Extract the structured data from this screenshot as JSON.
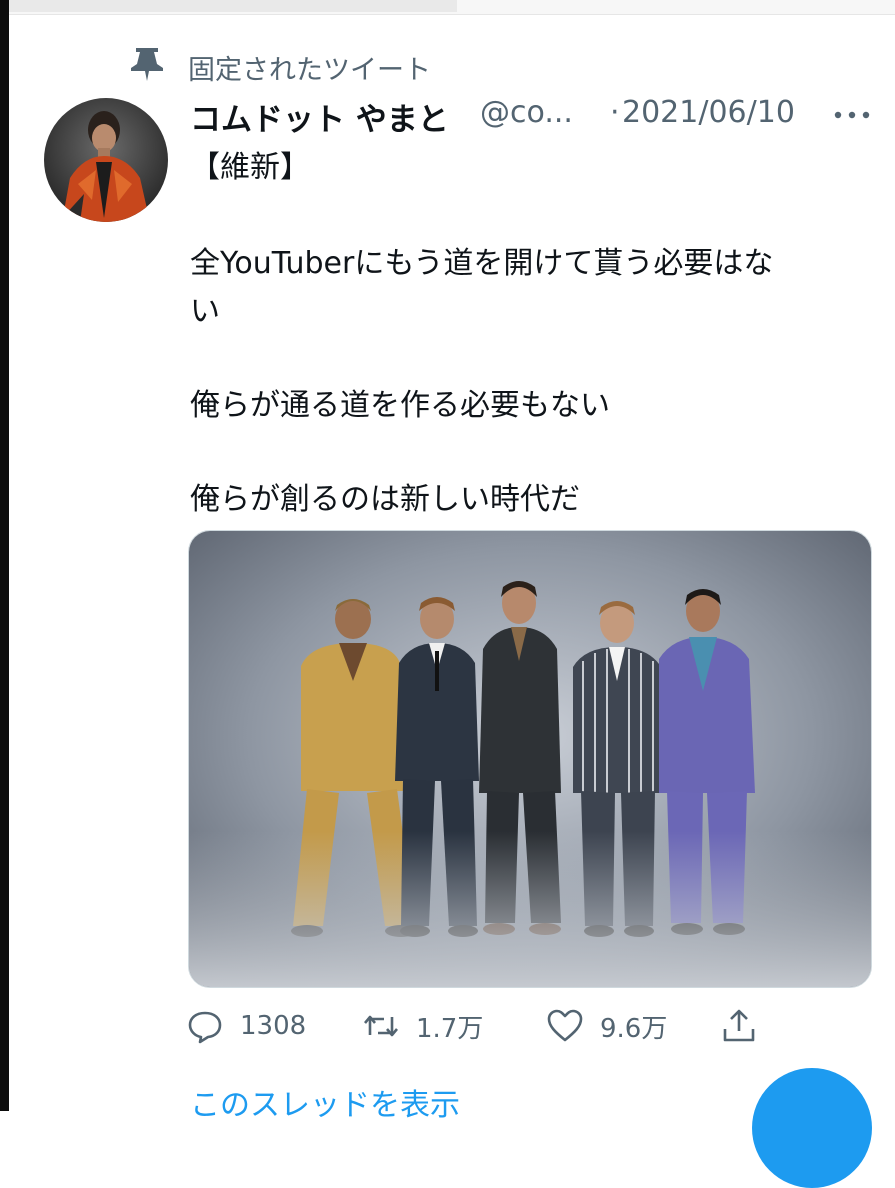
{
  "colors": {
    "accent": "#1d9bf0",
    "secondary_text": "#536471",
    "primary_text": "#0f1419"
  },
  "pinned": {
    "icon": "pin-icon",
    "label": "固定されたツイート"
  },
  "tweet": {
    "display_name": "コムドット やまと",
    "handle": "@co...",
    "separator": "·",
    "date": "2021/06/10",
    "lines": [
      "【維新】",
      "全YouTuberにもう道を開けて貰う必要はな",
      "い",
      "俺らが通る道を作る必要もない",
      "俺らが創るのは新しい時代だ"
    ]
  },
  "actions": {
    "reply_count": "1308",
    "retweet_count": "1.7万",
    "like_count": "9.6万"
  },
  "thread_link": "このスレッドを表示"
}
